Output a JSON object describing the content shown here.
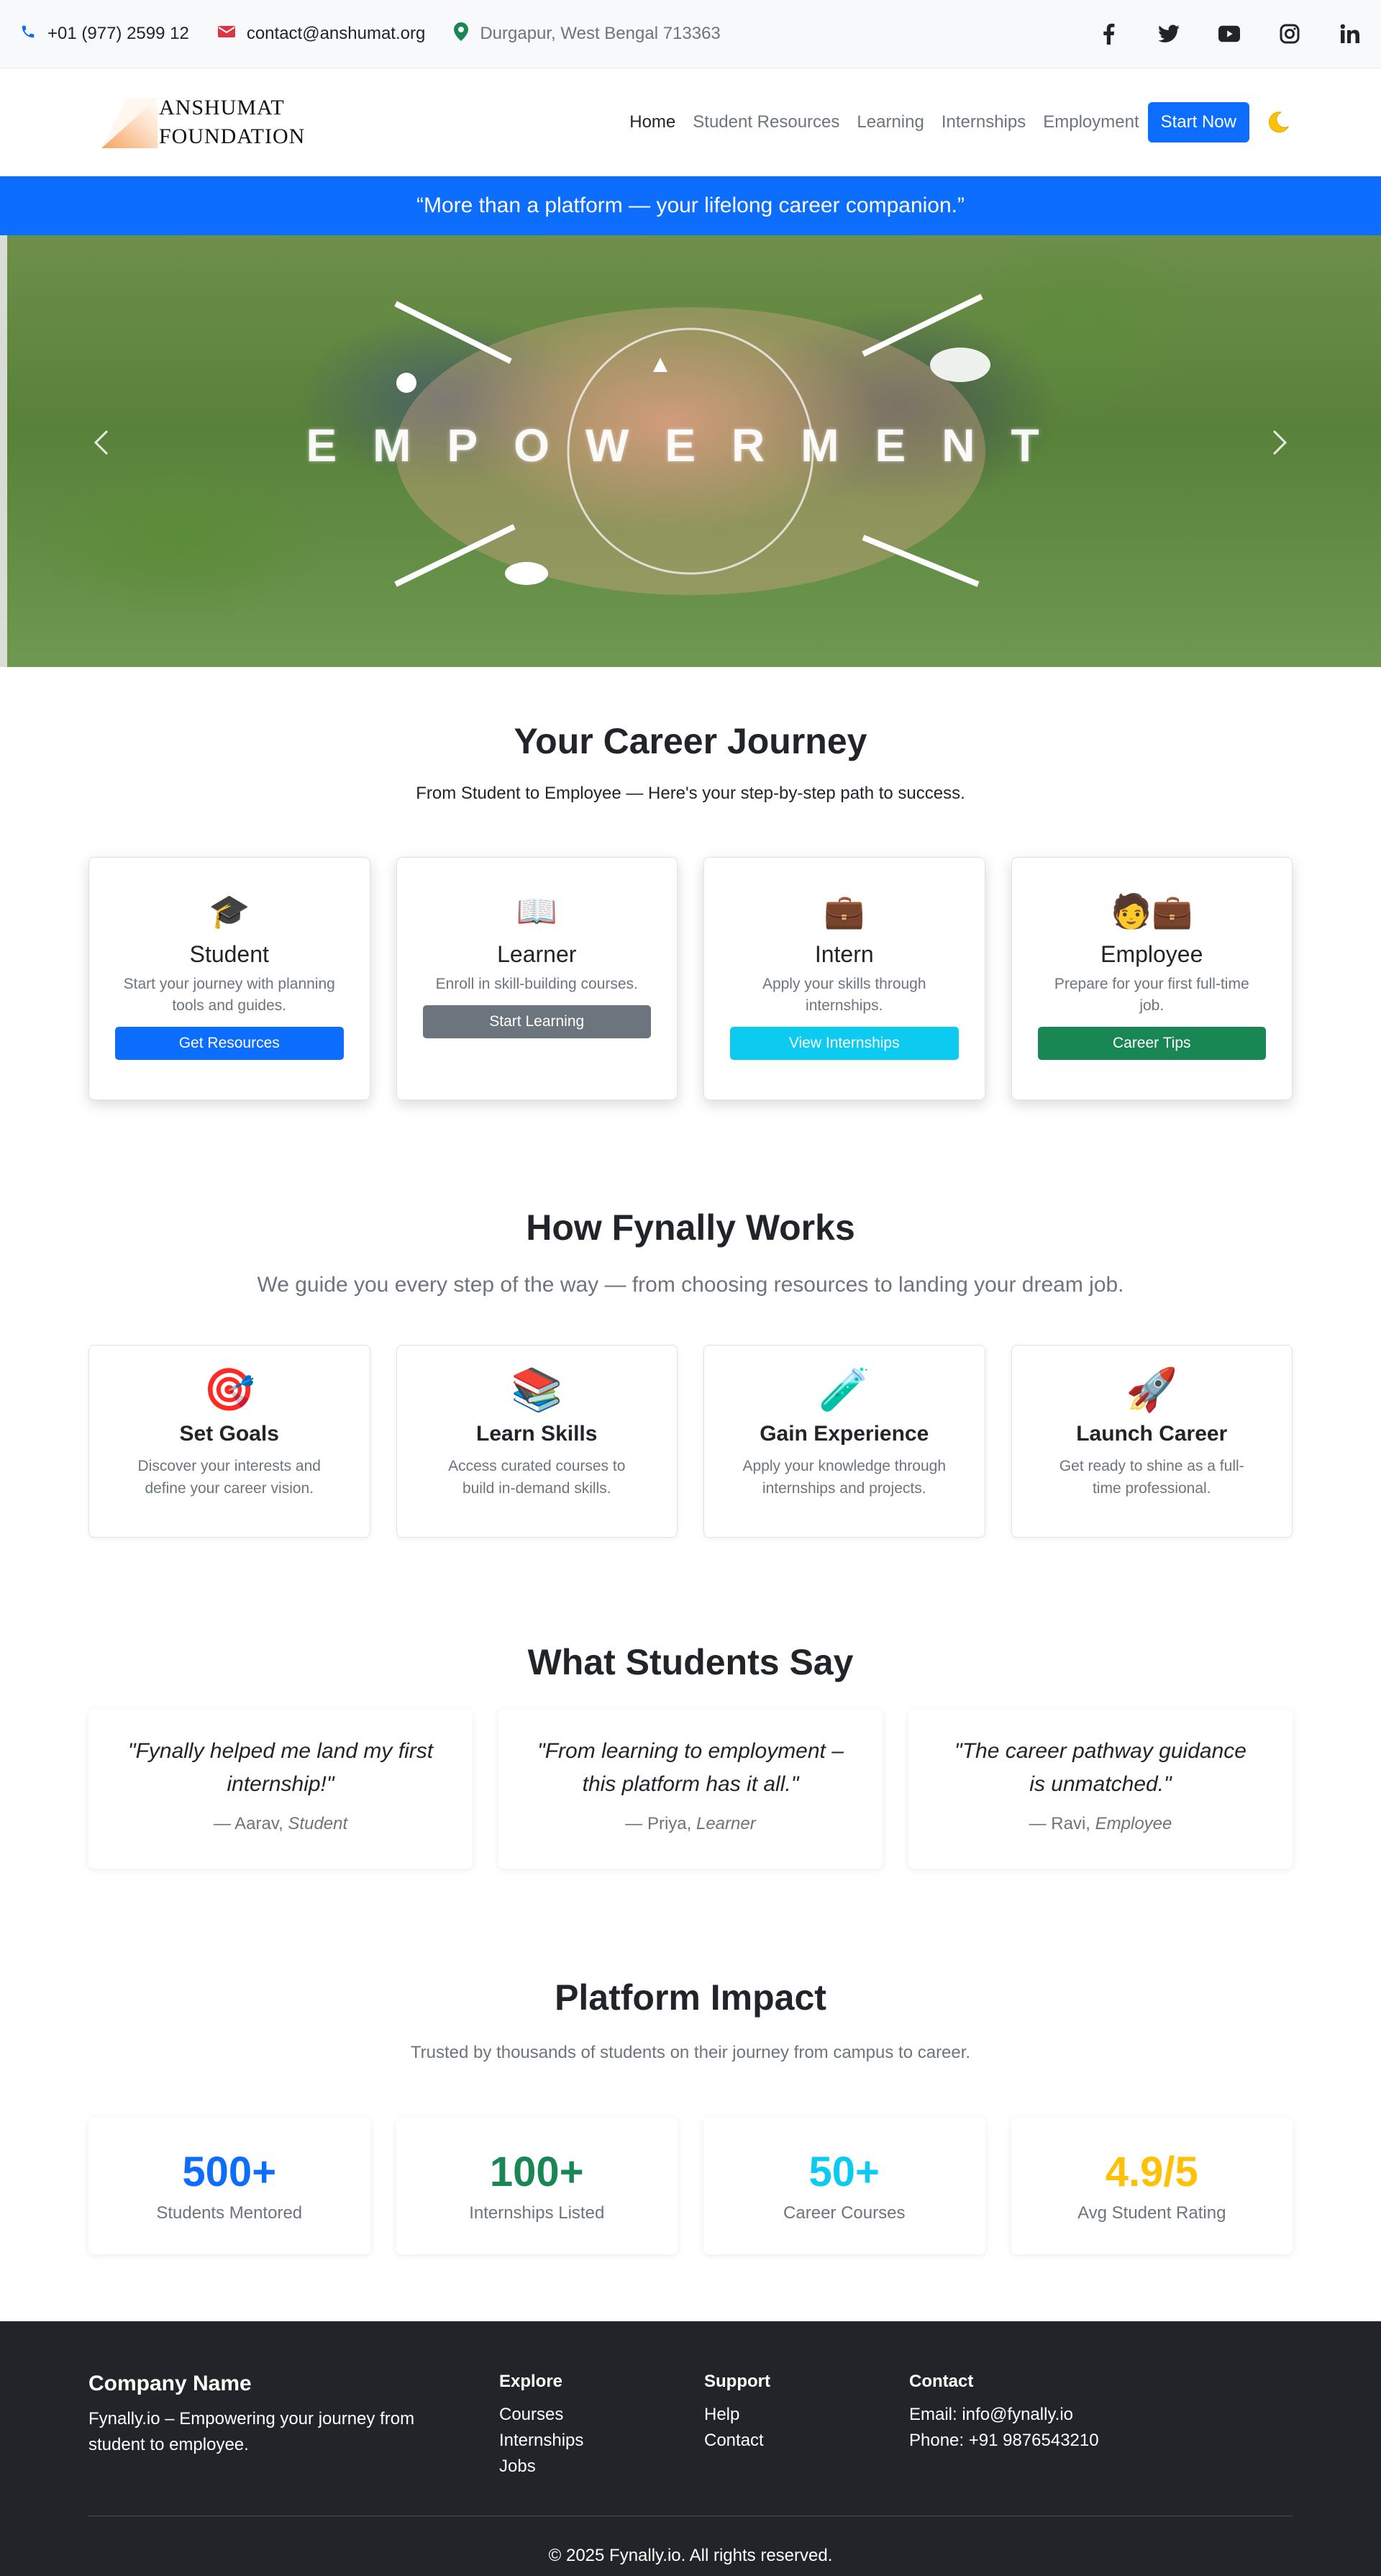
{
  "topbar": {
    "phone": "+01 (977) 2599 12",
    "email": "contact@anshumat.org",
    "address": "Durgapur, West Bengal 713363",
    "socials": [
      "facebook-icon",
      "twitter-icon",
      "youtube-icon",
      "instagram-icon",
      "linkedin-icon"
    ]
  },
  "brand": {
    "line1": "ANSHUMAT",
    "line2": "FOUNDATION"
  },
  "nav": {
    "items": [
      "Home",
      "Student Resources",
      "Learning",
      "Internships",
      "Employment"
    ],
    "cta": "Start Now",
    "theme_toggle": "moon-icon"
  },
  "banner": {
    "quote": "“More than a platform — your lifelong career companion.”"
  },
  "hero": {
    "word": "EMPOWERMENT"
  },
  "journey": {
    "title": "Your Career Journey",
    "subtitle": "From Student to Employee — Here's your step-by-step path to success.",
    "cards": [
      {
        "emoji": "🎓",
        "title": "Student",
        "text": "Start your journey with planning tools and guides.",
        "button": "Get Resources",
        "color": "#0d6efd"
      },
      {
        "emoji": "📖",
        "title": "Learner",
        "text": "Enroll in skill-building courses.",
        "button": "Start Learning",
        "color": "#6c757d"
      },
      {
        "emoji": "💼",
        "title": "Intern",
        "text": "Apply your skills through internships.",
        "button": "View Internships",
        "color": "#0dcaf0"
      },
      {
        "emoji": "🧑💼",
        "title": "Employee",
        "text": "Prepare for your first full-time job.",
        "button": "Career Tips",
        "color": "#198754"
      }
    ]
  },
  "works": {
    "title": "How Fynally Works",
    "subtitle": "We guide you every step of the way — from choosing resources to landing your dream job.",
    "cards": [
      {
        "emoji": "🎯",
        "title": "Set Goals",
        "text": "Discover your interests and define your career vision."
      },
      {
        "emoji": "📚",
        "title": "Learn Skills",
        "text": "Access curated courses to build in-demand skills."
      },
      {
        "emoji": "🧪",
        "title": "Gain Experience",
        "text": "Apply your knowledge through internships and projects."
      },
      {
        "emoji": "🚀",
        "title": "Launch Career",
        "text": "Get ready to shine as a full-time professional."
      }
    ]
  },
  "testimonials": {
    "title": "What Students Say",
    "items": [
      {
        "quote": "\"Fynally helped me land my first internship!\"",
        "name": "— Aarav, ",
        "role": "Student"
      },
      {
        "quote": "\"From learning to employment – this platform has it all.\"",
        "name": "— Priya, ",
        "role": "Learner"
      },
      {
        "quote": "\"The career pathway guidance is unmatched.\"",
        "name": "— Ravi, ",
        "role": "Employee"
      }
    ]
  },
  "impact": {
    "title": "Platform Impact",
    "subtitle": "Trusted by thousands of students on their journey from campus to career.",
    "stats": [
      {
        "value": "500+",
        "label": "Students Mentored",
        "color": "#0d6efd"
      },
      {
        "value": "100+",
        "label": "Internships Listed",
        "color": "#198754"
      },
      {
        "value": "50+",
        "label": "Career Courses",
        "color": "#0dcaf0"
      },
      {
        "value": "4.9/5",
        "label": "Avg Student Rating",
        "color": "#ffc107"
      }
    ]
  },
  "footer": {
    "company": "Company Name",
    "about": "Fynally.io – Empowering your journey from student to employee.",
    "explore": {
      "title": "Explore",
      "links": [
        "Courses",
        "Internships",
        "Jobs"
      ]
    },
    "support": {
      "title": "Support",
      "links": [
        "Help",
        "Contact"
      ]
    },
    "contact": {
      "title": "Contact",
      "email": "Email: info@fynally.io",
      "phone": "Phone: +91 9876543210"
    },
    "copyright": "© 2025 Fynally.io. All rights reserved."
  }
}
